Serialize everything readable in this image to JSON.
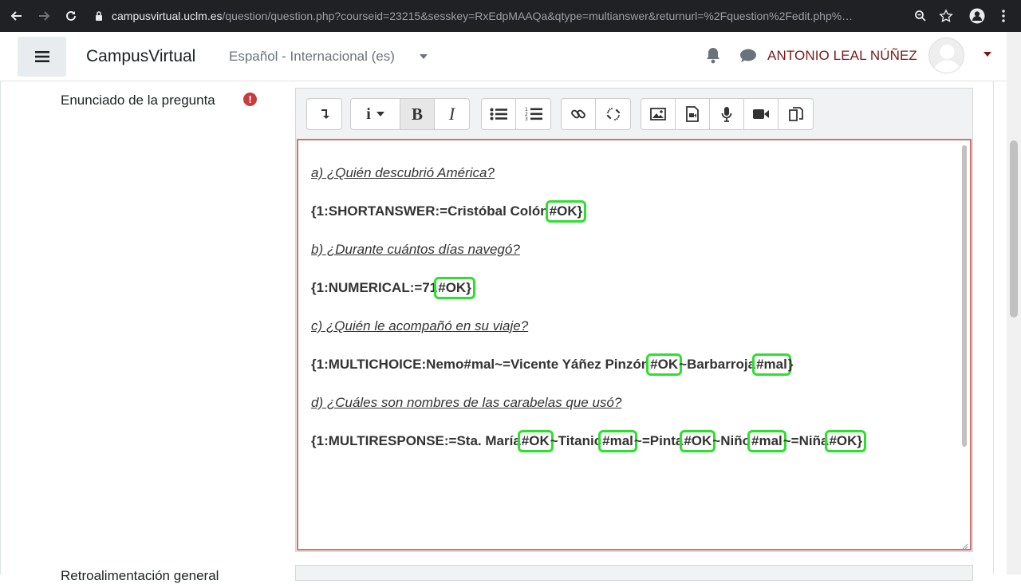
{
  "browser": {
    "url_host": "campusvirtual.uclm.es",
    "url_path": "/question/question.php?courseid=23215&sesskey=RxEdpMAAQa&qtype=multianswer&returnurl=%2Fquestion%2Fedit.php%…"
  },
  "header": {
    "brand": "CampusVirtual",
    "language": "Español - Internacional (es)",
    "user_name": "ANTONIO LEAL NÚÑEZ"
  },
  "form": {
    "field_label": "Enunciado de la pregunta",
    "required_mark": "!",
    "bottom_label": "Retroalimentación general"
  },
  "toolbar": {
    "icons": [
      "collapse-icon",
      "info-icon",
      "bold-icon",
      "italic-icon",
      "unordered-list-icon",
      "ordered-list-icon",
      "link-icon",
      "unlink-icon",
      "image-icon",
      "media-icon",
      "record-audio-icon",
      "record-video-icon",
      "manage-files-icon"
    ],
    "bold_label": "B",
    "italic_label": "I",
    "info_label": "i"
  },
  "editor": {
    "lines": [
      {
        "kind": "question",
        "text": "a)  ¿Quién descubrió América?"
      },
      {
        "kind": "code",
        "segments": [
          {
            "text": "{1:SHORTANSWER:=Cristóbal Colón",
            "hl": false
          },
          {
            "text": "#OK}",
            "hl": true
          }
        ]
      },
      {
        "kind": "question",
        "text": "b)  ¿Durante cuántos días navegó?"
      },
      {
        "kind": "code",
        "segments": [
          {
            "text": "{1:NUMERICAL:=71",
            "hl": false
          },
          {
            "text": "#OK}",
            "hl": true
          }
        ]
      },
      {
        "kind": "question",
        "text": "c)  ¿Quién le acompañó en su viaje?"
      },
      {
        "kind": "code",
        "segments": [
          {
            "text": "{1:MULTICHOICE:Nemo#mal~=Vicente Yáñez Pinzón",
            "hl": false
          },
          {
            "text": "#OK",
            "hl": true
          },
          {
            "text": "~Barbarroja",
            "hl": false
          },
          {
            "text": "#mal",
            "hl": true
          },
          {
            "text": "}",
            "hl": false
          }
        ]
      },
      {
        "kind": "question",
        "text": "d)  ¿Cuáles son nombres de las carabelas que usó?"
      },
      {
        "kind": "code",
        "segments": [
          {
            "text": "{1:MULTIRESPONSE:=Sta. María",
            "hl": false
          },
          {
            "text": "#OK",
            "hl": true
          },
          {
            "text": "~Titanic",
            "hl": false
          },
          {
            "text": "#mal",
            "hl": true
          },
          {
            "text": "~=Pinta",
            "hl": false
          },
          {
            "text": "#OK",
            "hl": true
          },
          {
            "text": "~Niño",
            "hl": false
          },
          {
            "text": "#mal",
            "hl": true
          },
          {
            "text": "~=Niña",
            "hl": false
          },
          {
            "text": "#OK}",
            "hl": true
          }
        ]
      }
    ]
  }
}
